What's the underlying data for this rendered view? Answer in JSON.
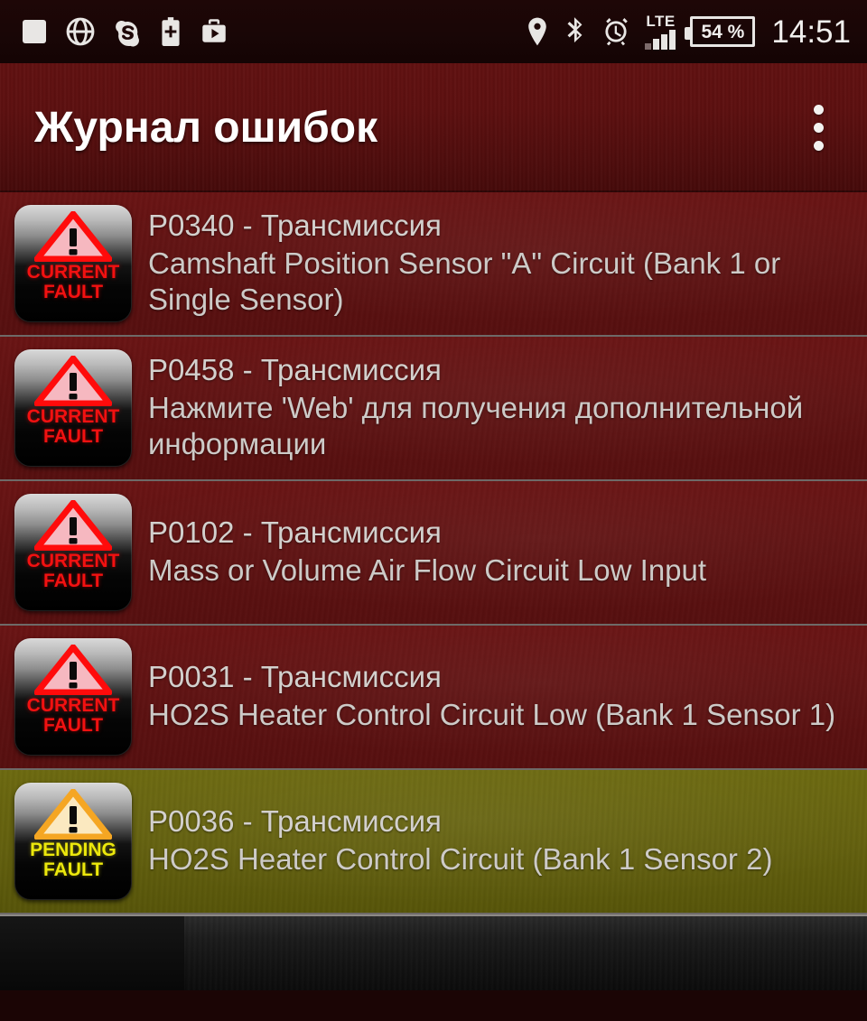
{
  "statusbar": {
    "left_icons": [
      {
        "name": "screenshot-icon",
        "glyph": "square"
      },
      {
        "name": "globe-icon",
        "glyph": "globe"
      },
      {
        "name": "skype-icon",
        "glyph": "skype"
      },
      {
        "name": "battery-plus-icon",
        "glyph": "battery-plus"
      },
      {
        "name": "play-store-briefcase-icon",
        "glyph": "briefcase-play"
      }
    ],
    "right_icons": [
      {
        "name": "location-icon",
        "glyph": "pin"
      },
      {
        "name": "bluetooth-icon",
        "glyph": "bluetooth"
      },
      {
        "name": "alarm-icon",
        "glyph": "alarm"
      }
    ],
    "network_label": "LTE",
    "signal_bars": 4,
    "battery_percent": "54 %",
    "clock": "14:51"
  },
  "titlebar": {
    "title": "Журнал ошибок",
    "overflow_menu": "⋮"
  },
  "colors": {
    "current_fault_row": "#5e1111",
    "pending_fault_row": "#63600e",
    "current_fault_text": "#f21111",
    "pending_fault_text": "#ece80c",
    "title_bar": "#5d0f0f",
    "status_bar": "#190606",
    "body_text": "#cdcac7"
  },
  "list": {
    "items": [
      {
        "status": "current",
        "badge_line1": "CURRENT",
        "badge_line2": "FAULT",
        "code": "P0340 - Трансмиссия",
        "description": "Camshaft Position Sensor \"A\" Circuit (Bank 1 or Single Sensor)"
      },
      {
        "status": "current",
        "badge_line1": "CURRENT",
        "badge_line2": "FAULT",
        "code": "P0458 - Трансмиссия",
        "description": "Нажмите 'Web' для получения дополнительной информации"
      },
      {
        "status": "current",
        "badge_line1": "CURRENT",
        "badge_line2": "FAULT",
        "code": "P0102 - Трансмиссия",
        "description": "Mass or Volume Air Flow Circuit Low Input"
      },
      {
        "status": "current",
        "badge_line1": "CURRENT",
        "badge_line2": "FAULT",
        "code": "P0031 - Трансмиссия",
        "description": "HO2S Heater Control Circuit Low (Bank 1 Sensor 1)"
      },
      {
        "status": "pending",
        "badge_line1": "PENDING",
        "badge_line2": "FAULT",
        "code": "P0036 - Трансмиссия",
        "description": "HO2S Heater Control Circuit (Bank 1 Sensor 2)"
      }
    ]
  }
}
